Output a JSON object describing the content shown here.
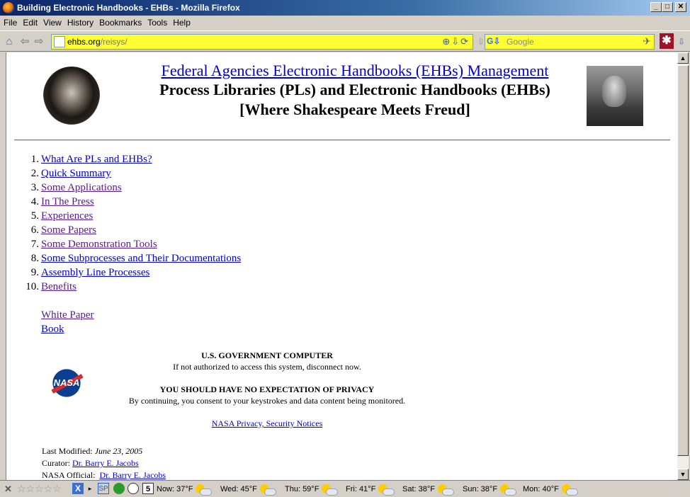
{
  "window": {
    "title": "Building Electronic Handbooks - EHBs - Mozilla Firefox"
  },
  "menu": [
    "File",
    "Edit",
    "View",
    "History",
    "Bookmarks",
    "Tools",
    "Help"
  ],
  "navbar": {
    "url_host": "ehbs.org",
    "url_path": "/reisys/",
    "search_placeholder": "Google"
  },
  "page": {
    "title_link": "Federal Agencies Electronic Handbooks (EHBs) Management",
    "subtitle1": "Process Libraries (PLs) and Electronic Handbooks (EHBs)",
    "subtitle2": "[Where Shakespeare Meets Freud]",
    "toc": [
      {
        "num": "1.",
        "label": "What Are PLs and EHBs?",
        "visited": false
      },
      {
        "num": "2.",
        "label": "Quick Summary",
        "visited": false
      },
      {
        "num": "3.",
        "label": "Some Applications",
        "visited": true
      },
      {
        "num": "4.",
        "label": "In The Press",
        "visited": true
      },
      {
        "num": "5.",
        "label": "Experiences",
        "visited": true
      },
      {
        "num": "6.",
        "label": "Some Papers",
        "visited": true
      },
      {
        "num": "7.",
        "label": "Some Demonstration Tools",
        "visited": true
      },
      {
        "num": "8.",
        "label": "Some Subprocesses and Their Documentations",
        "visited": false
      },
      {
        "num": "9.",
        "label": "Assembly Line Processes",
        "visited": false
      },
      {
        "num": "10.",
        "label": "Benefits",
        "visited": true
      }
    ],
    "extra_links": {
      "white_paper": "White Paper",
      "book": "Book"
    },
    "nasa_logo_text": "NASA",
    "notice": {
      "line1": "U.S. GOVERNMENT COMPUTER",
      "line2": "If not authorized to access this system, disconnect now.",
      "line3": "YOU SHOULD HAVE NO EXPECTATION OF PRIVACY",
      "line4": "By continuing, you consent to your keystrokes and data content being monitored.",
      "link": "NASA Privacy, Security Notices"
    },
    "footer": {
      "modified_label": "Last Modified:",
      "modified_date": "June 23, 2005",
      "curator_label": "Curator:",
      "curator_name": "Dr. Barry E. Jacobs",
      "official_label": "NASA Official:",
      "official_name": "Dr. Barry E. Jacobs"
    }
  },
  "statusbar": {
    "sp_label": "SP",
    "calendar_day": "5",
    "weather": [
      {
        "label": "Now: 37°F"
      },
      {
        "label": "Wed: 45°F"
      },
      {
        "label": "Thu: 59°F"
      },
      {
        "label": "Fri: 41°F"
      },
      {
        "label": "Sat: 38°F"
      },
      {
        "label": "Sun: 38°F"
      },
      {
        "label": "Mon: 40°F"
      }
    ]
  }
}
